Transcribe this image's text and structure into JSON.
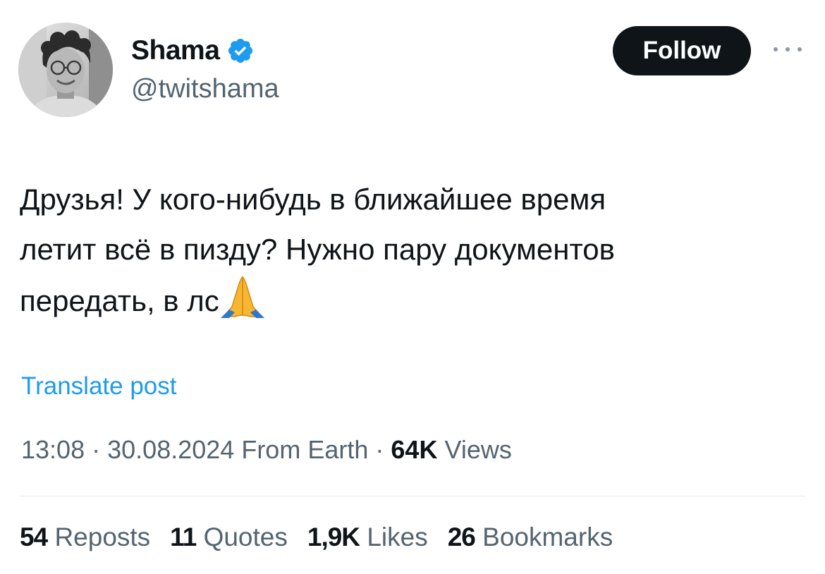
{
  "author": {
    "display_name": "Shama",
    "handle": "@twitshama",
    "verified": true,
    "avatar_icon": "avatar-photo"
  },
  "actions": {
    "follow_label": "Follow",
    "more_icon": "more-horizontal-icon"
  },
  "post": {
    "text": "Друзья! У кого-нибудь в ближайшее время\nлетит всё в пизду? Нужно пару документов\nпередать, в лс",
    "emoji": "folded-hands-emoji",
    "translate_label": "Translate post"
  },
  "meta": {
    "time": "13:08",
    "separator": "·",
    "date": "30.08.2024",
    "source": "From Earth",
    "views_count": "64K",
    "views_label": "Views"
  },
  "stats": {
    "reposts_count": "54",
    "reposts_label": "Reposts",
    "quotes_count": "11",
    "quotes_label": "Quotes",
    "likes_count": "1,9K",
    "likes_label": "Likes",
    "bookmarks_count": "26",
    "bookmarks_label": "Bookmarks"
  },
  "colors": {
    "text_primary": "#0f1419",
    "text_secondary": "#536471",
    "accent_blue": "#1d9bf0",
    "follow_bg": "#0f1419",
    "divider": "#e6e9eb"
  }
}
